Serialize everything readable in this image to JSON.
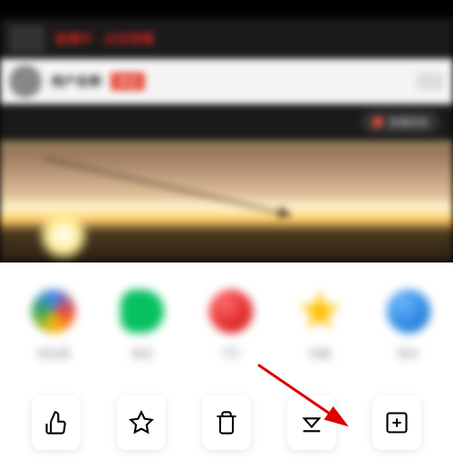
{
  "banner": {
    "text": "直播中 · 点击观看"
  },
  "profile": {
    "name": "用户名称",
    "tag": "关注"
  },
  "live": {
    "label": "直播回放"
  },
  "share": [
    {
      "label": "朋友圈"
    },
    {
      "label": "微信"
    },
    {
      "label": "QQ"
    },
    {
      "label": "收藏"
    },
    {
      "label": "更多"
    }
  ],
  "actions": {
    "like": "赞",
    "favorite": "收藏",
    "delete": "删除",
    "download": "下载",
    "more": "更多"
  }
}
